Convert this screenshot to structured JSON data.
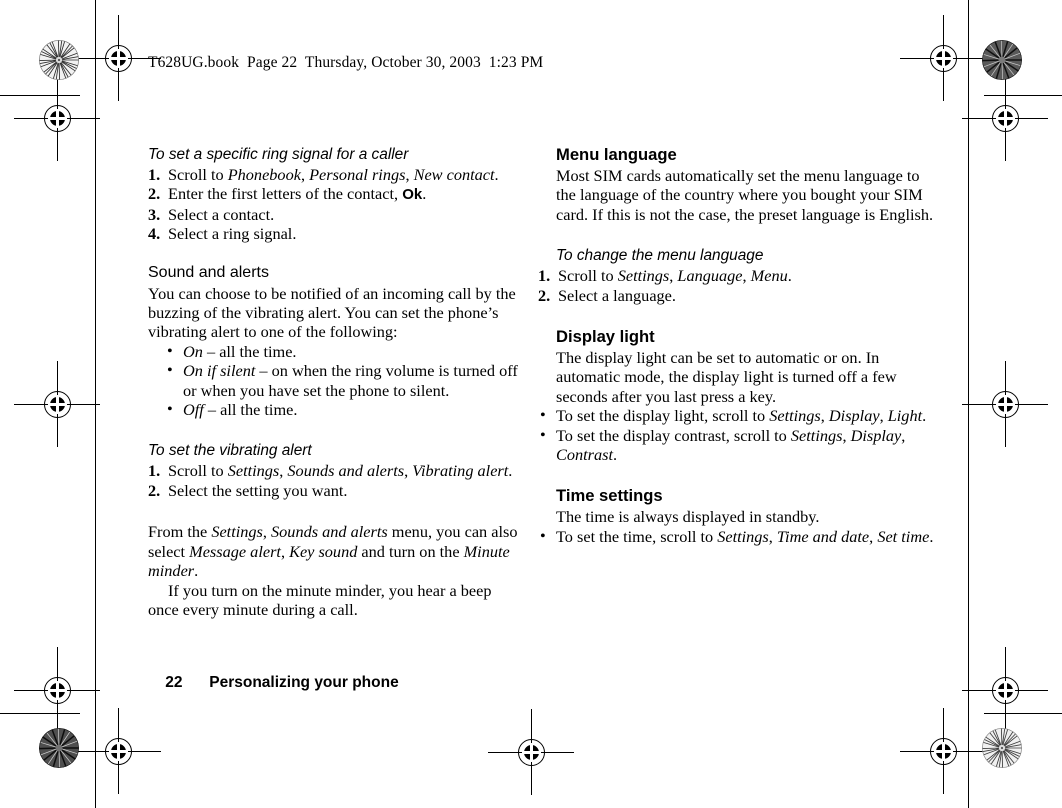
{
  "header": {
    "running_header": "T628UG.book  Page 22  Thursday, October 30, 2003  1:23 PM"
  },
  "footer": {
    "page_number": "22",
    "chapter_title": "Personalizing your phone"
  },
  "left_column": {
    "procedure_ring_signal": {
      "heading": "To set a specific ring signal for a caller",
      "steps": [
        {
          "num": "1.",
          "text_parts": [
            "Scroll to ",
            "Phonebook",
            ", ",
            "Personal rings",
            ", ",
            "New contact",
            "."
          ]
        },
        {
          "num": "2.",
          "text_parts": [
            "Enter the first letters of the contact, ",
            "Ok",
            "."
          ]
        },
        {
          "num": "3.",
          "text_parts": [
            "Select a contact."
          ]
        },
        {
          "num": "4.",
          "text_parts": [
            "Select a ring signal."
          ]
        }
      ]
    },
    "sound_and_alerts": {
      "heading": "Sound and alerts",
      "body": "You can choose to be notified of an incoming call by the buzzing of the vibrating alert. You can set the phone’s vibrating alert to one of the following:",
      "bullets": [
        {
          "term": "On",
          "rest": " – all the time."
        },
        {
          "term": "On if silent",
          "rest": " – on when the ring volume is turned off or when you have set the phone to silent."
        },
        {
          "term": "Off",
          "rest": " – all the time."
        }
      ]
    },
    "procedure_vibrating_alert": {
      "heading": "To set the vibrating alert",
      "steps": [
        {
          "num": "1.",
          "text_parts": [
            "Scroll to ",
            "Settings",
            ", ",
            "Sounds and alerts",
            ", ",
            "Vibrating alert",
            "."
          ]
        },
        {
          "num": "2.",
          "text_parts": [
            "Select the setting you want."
          ]
        }
      ]
    },
    "closing": {
      "para1_parts": [
        "From the ",
        "Settings",
        ", ",
        "Sounds and alerts",
        " menu, you can also select ",
        "Message alert",
        ", ",
        "Key sound",
        " and turn on the ",
        "Minute minder",
        "."
      ],
      "para2": "If you turn on the minute minder, you hear a beep once every minute during a call."
    }
  },
  "right_column": {
    "menu_language": {
      "heading": "Menu language",
      "body": "Most SIM cards automatically set the menu language to the language of the country where you bought your SIM card. If this is not the case, the preset language is English."
    },
    "procedure_change_language": {
      "heading": "To change the menu language",
      "steps": [
        {
          "num": "1.",
          "text_parts": [
            "Scroll to ",
            "Settings",
            ", ",
            "Language",
            ", ",
            "Menu",
            "."
          ]
        },
        {
          "num": "2.",
          "text_parts": [
            "Select a language."
          ]
        }
      ]
    },
    "display_light": {
      "heading": "Display light",
      "body": "The display light can be set to automatic or on. In automatic mode, the display light is turned off a few seconds after you last press a key.",
      "bullets": [
        {
          "parts": [
            "To set the display light, scroll to ",
            "Settings",
            ", ",
            "Display",
            ", ",
            "Light",
            "."
          ]
        },
        {
          "parts": [
            "To set the display contrast, scroll to ",
            "Settings",
            ", ",
            "Display",
            ", ",
            "Contrast",
            "."
          ]
        }
      ]
    },
    "time_settings": {
      "heading": "Time settings",
      "body": "The time is always displayed in standby.",
      "bullets": [
        {
          "parts": [
            "To set the time, scroll to ",
            "Settings",
            ", ",
            "Time and date",
            ", ",
            "Set time",
            "."
          ]
        }
      ]
    }
  },
  "prepress": {
    "bullet_glyph": "•",
    "colors": {
      "ink": "#000000",
      "paper": "#ffffff"
    }
  }
}
